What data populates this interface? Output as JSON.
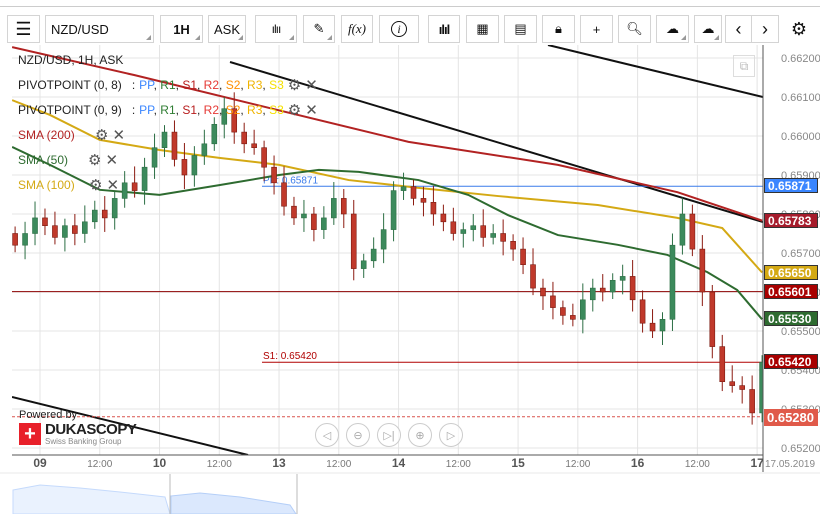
{
  "toolbar": {
    "symbol": "NZD/USD",
    "timeframe": "1H",
    "side": "ASK",
    "icons": [
      "menu-icon",
      "candles-icon",
      "pencil-icon",
      "function-icon",
      "info-icon",
      "bar-chart-icon",
      "calendar-icon",
      "news-icon",
      "lock-icon",
      "crosshair-icon",
      "zoom-chart-icon",
      "upload-cloud-icon",
      "download-cloud-icon",
      "chevron-left-icon",
      "chevron-right-icon",
      "gear-icon"
    ],
    "fx_label": "f(x)",
    "info_label": "i"
  },
  "legend": {
    "title": "NZD/USD, 1H, ASK",
    "pivots": [
      {
        "name": "PIVOTPOINT (0, 8)",
        "sep": ":",
        "items": [
          {
            "t": "PP",
            "c": "#3a86ff"
          },
          {
            "t": "R1",
            "c": "#2e7d32"
          },
          {
            "t": "S1",
            "c": "#b71c1c"
          },
          {
            "t": "R2",
            "c": "#e53935"
          },
          {
            "t": "S2",
            "c": "#ff8f00"
          },
          {
            "t": "R3",
            "c": "#f0b400"
          },
          {
            "t": "S3",
            "c": "#f5e100"
          }
        ]
      },
      {
        "name": "PIVOTPOINT (0, 9)",
        "sep": ":",
        "items": [
          {
            "t": "PP",
            "c": "#3a86ff"
          },
          {
            "t": "R1",
            "c": "#2e7d32"
          },
          {
            "t": "S1",
            "c": "#b71c1c"
          },
          {
            "t": "R2",
            "c": "#e53935"
          },
          {
            "t": "S2",
            "c": "#ff8f00"
          },
          {
            "t": "R3",
            "c": "#f0b400"
          },
          {
            "t": "S3",
            "c": "#f5e100"
          }
        ]
      }
    ],
    "smas": [
      {
        "name": "SMA (200)",
        "color": "#b22222"
      },
      {
        "name": "SMA (50)",
        "color": "#2e6b30"
      },
      {
        "name": "SMA (100)",
        "color": "#d4a914"
      }
    ]
  },
  "chart_data": {
    "type": "candlestick",
    "title": "NZD/USD, 1H, ASK",
    "ylim": [
      0.6519,
      0.66225
    ],
    "y_ticks": [
      "0.66200",
      "0.66100",
      "0.66000",
      "0.65900",
      "0.65800",
      "0.65700",
      "0.65600",
      "0.65500",
      "0.65400",
      "0.65300",
      "0.65200"
    ],
    "x_ticks": [
      {
        "h": 0,
        "label": "09",
        "major": true
      },
      {
        "h": 12,
        "label": "12:00"
      },
      {
        "h": 24,
        "label": "10",
        "major": true
      },
      {
        "h": 36,
        "label": "12:00"
      },
      {
        "h": 48,
        "label": "13",
        "major": true
      },
      {
        "h": 60,
        "label": "12:00"
      },
      {
        "h": 72,
        "label": "14",
        "major": true
      },
      {
        "h": 84,
        "label": "12:00"
      },
      {
        "h": 96,
        "label": "15",
        "major": true
      },
      {
        "h": 108,
        "label": "12:00"
      },
      {
        "h": 120,
        "label": "16",
        "major": true
      },
      {
        "h": 132,
        "label": "12:00"
      },
      {
        "h": 144,
        "label": "17",
        "major": true
      }
    ],
    "end_date": "17.05.2019",
    "candle_start_hour": -5,
    "candle_step_hours": 2,
    "closes": [
      0.6572,
      0.6575,
      0.6579,
      0.6577,
      0.6574,
      0.6577,
      0.6575,
      0.6578,
      0.6581,
      0.6579,
      0.6584,
      0.6588,
      0.6586,
      0.6592,
      0.6597,
      0.6601,
      0.6594,
      0.659,
      0.6595,
      0.6598,
      0.6603,
      0.6607,
      0.6601,
      0.6598,
      0.6597,
      0.6592,
      0.6588,
      0.6582,
      0.6579,
      0.658,
      0.6576,
      0.6579,
      0.6584,
      0.658,
      0.6566,
      0.6568,
      0.6571,
      0.6576,
      0.6586,
      0.6587,
      0.6584,
      0.6583,
      0.658,
      0.6578,
      0.6575,
      0.6576,
      0.6577,
      0.6574,
      0.6575,
      0.6573,
      0.6571,
      0.6567,
      0.6561,
      0.6559,
      0.6556,
      0.6554,
      0.6553,
      0.6558,
      0.6561,
      0.656,
      0.6563,
      0.6564,
      0.6558,
      0.6552,
      0.655,
      0.6553,
      0.6572,
      0.658,
      0.6571,
      0.656,
      0.6546,
      0.6537,
      0.6536,
      0.6535,
      0.6529,
      0.6542
    ],
    "series": [
      {
        "name": "SMA (200)",
        "color": "#b22222",
        "points": [
          [
            -5.6,
            0.66228
          ],
          [
            19,
            0.66156
          ],
          [
            74,
            0.65985
          ],
          [
            104,
            0.65926
          ],
          [
            128,
            0.65856
          ],
          [
            145,
            0.65783
          ]
        ]
      },
      {
        "name": "SMA (100)",
        "color": "#d4a914",
        "points": [
          [
            -5.6,
            0.66092
          ],
          [
            2,
            0.66054
          ],
          [
            12,
            0.6599
          ],
          [
            24,
            0.65964
          ],
          [
            36,
            0.65944
          ],
          [
            48,
            0.65926
          ],
          [
            62,
            0.65887
          ],
          [
            76,
            0.65867
          ],
          [
            92,
            0.65846
          ],
          [
            112,
            0.65823
          ],
          [
            128,
            0.6579
          ],
          [
            137,
            0.65764
          ],
          [
            145,
            0.6565
          ]
        ]
      },
      {
        "name": "SMA (50)",
        "color": "#2e6b30",
        "points": [
          [
            -5.6,
            0.65972
          ],
          [
            2,
            0.65926
          ],
          [
            12,
            0.65862
          ],
          [
            24,
            0.65849
          ],
          [
            36,
            0.65874
          ],
          [
            48,
            0.659
          ],
          [
            56,
            0.65913
          ],
          [
            64,
            0.65908
          ],
          [
            76,
            0.65887
          ],
          [
            86,
            0.65849
          ],
          [
            94,
            0.65797
          ],
          [
            104,
            0.65746
          ],
          [
            116,
            0.65721
          ],
          [
            126,
            0.65695
          ],
          [
            134,
            0.65651
          ],
          [
            140,
            0.65605
          ],
          [
            145,
            0.6553
          ]
        ]
      }
    ],
    "levels": [
      {
        "label": "PP: 0.65871",
        "value": 0.65871,
        "color": "#3a7bea"
      },
      {
        "label": "S1: 0.65420",
        "value": 0.6542,
        "color": "#b00000"
      }
    ],
    "price_labels": [
      {
        "text": "0.65871",
        "value": 0.65871,
        "bg": "#3a86ff"
      },
      {
        "text": "0.65783",
        "value": 0.65783,
        "bg": "#a61c2c"
      },
      {
        "text": "0.65650",
        "value": 0.6565,
        "bg": "#d4a914"
      },
      {
        "text": "0.65601",
        "value": 0.65601,
        "bg": "#a80000"
      },
      {
        "text": "0.65530",
        "value": 0.6553,
        "bg": "#2e6b30"
      },
      {
        "text": "0.65420",
        "value": 0.6542,
        "bg": "#a80000"
      },
      {
        "text": "0.65280",
        "value": 0.6528,
        "bg": "#e05a4a"
      }
    ]
  },
  "branding": {
    "powered_by": "Powered by",
    "name": "DUKASCOPY",
    "tagline": "Swiss Banking Group"
  }
}
